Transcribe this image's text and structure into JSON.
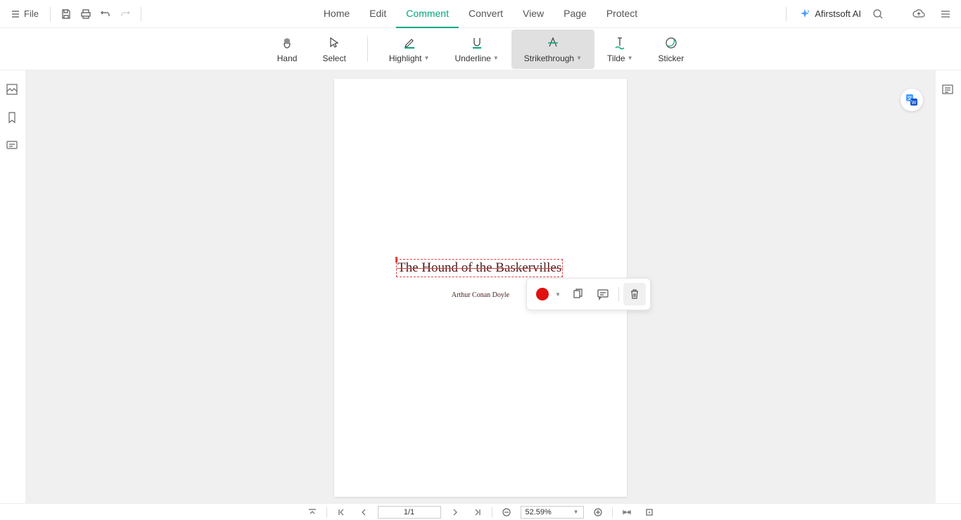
{
  "topmenu": {
    "file": "File"
  },
  "tabs": {
    "home": "Home",
    "edit": "Edit",
    "comment": "Comment",
    "convert": "Convert",
    "view": "View",
    "page": "Page",
    "protect": "Protect"
  },
  "ai": {
    "label": "Afirstsoft AI"
  },
  "tools": {
    "hand": "Hand",
    "select": "Select",
    "highlight": "Highlight",
    "underline": "Underline",
    "strikethrough": "Strikethrough",
    "tilde": "Tilde",
    "sticker": "Sticker"
  },
  "document": {
    "title": "The Hound of the Baskervilles",
    "author": "Arthur Conan Doyle"
  },
  "bottom": {
    "page": "1/1",
    "zoom": "52.59%"
  },
  "colors": {
    "accent": "#00a67e",
    "annotation": "#e01010"
  }
}
